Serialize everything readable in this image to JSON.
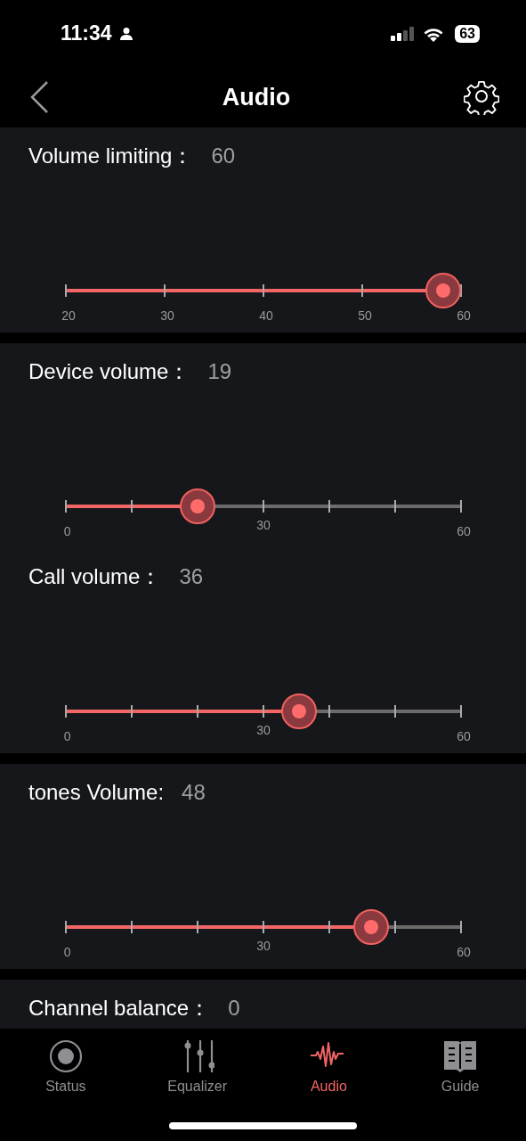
{
  "status_bar": {
    "time": "11:34",
    "battery": "63"
  },
  "header": {
    "title": "Audio"
  },
  "sections": [
    {
      "controls": [
        {
          "kind": "slider",
          "label": "Volume limiting：",
          "value": "60",
          "level": 1,
          "tick_labels": [
            "20",
            "30",
            "40",
            "50",
            "60"
          ]
        }
      ]
    },
    {
      "controls": [
        {
          "kind": "notched",
          "label": "Device volume：",
          "value": "19",
          "level": 0.317,
          "tick_labels": [
            "0",
            "30",
            "60"
          ]
        },
        {
          "kind": "notched",
          "label": "Call volume：",
          "value": "36",
          "level": 0.6,
          "tick_labels": [
            "0",
            "30",
            "60"
          ]
        }
      ]
    },
    {
      "controls": [
        {
          "kind": "notched",
          "label": "tones Volume:",
          "value": "48",
          "level": 0.8,
          "tick_labels": [
            "0",
            "30",
            "60"
          ]
        }
      ]
    },
    {
      "controls": [
        {
          "kind": "heading",
          "label": "Channel balance：",
          "value": "0"
        }
      ]
    }
  ],
  "tab_bar": [
    {
      "label": "Status",
      "selected": false
    },
    {
      "label": "Equalizer",
      "selected": false
    },
    {
      "label": "Audio",
      "selected": true
    },
    {
      "label": "Guide",
      "selected": false
    }
  ]
}
